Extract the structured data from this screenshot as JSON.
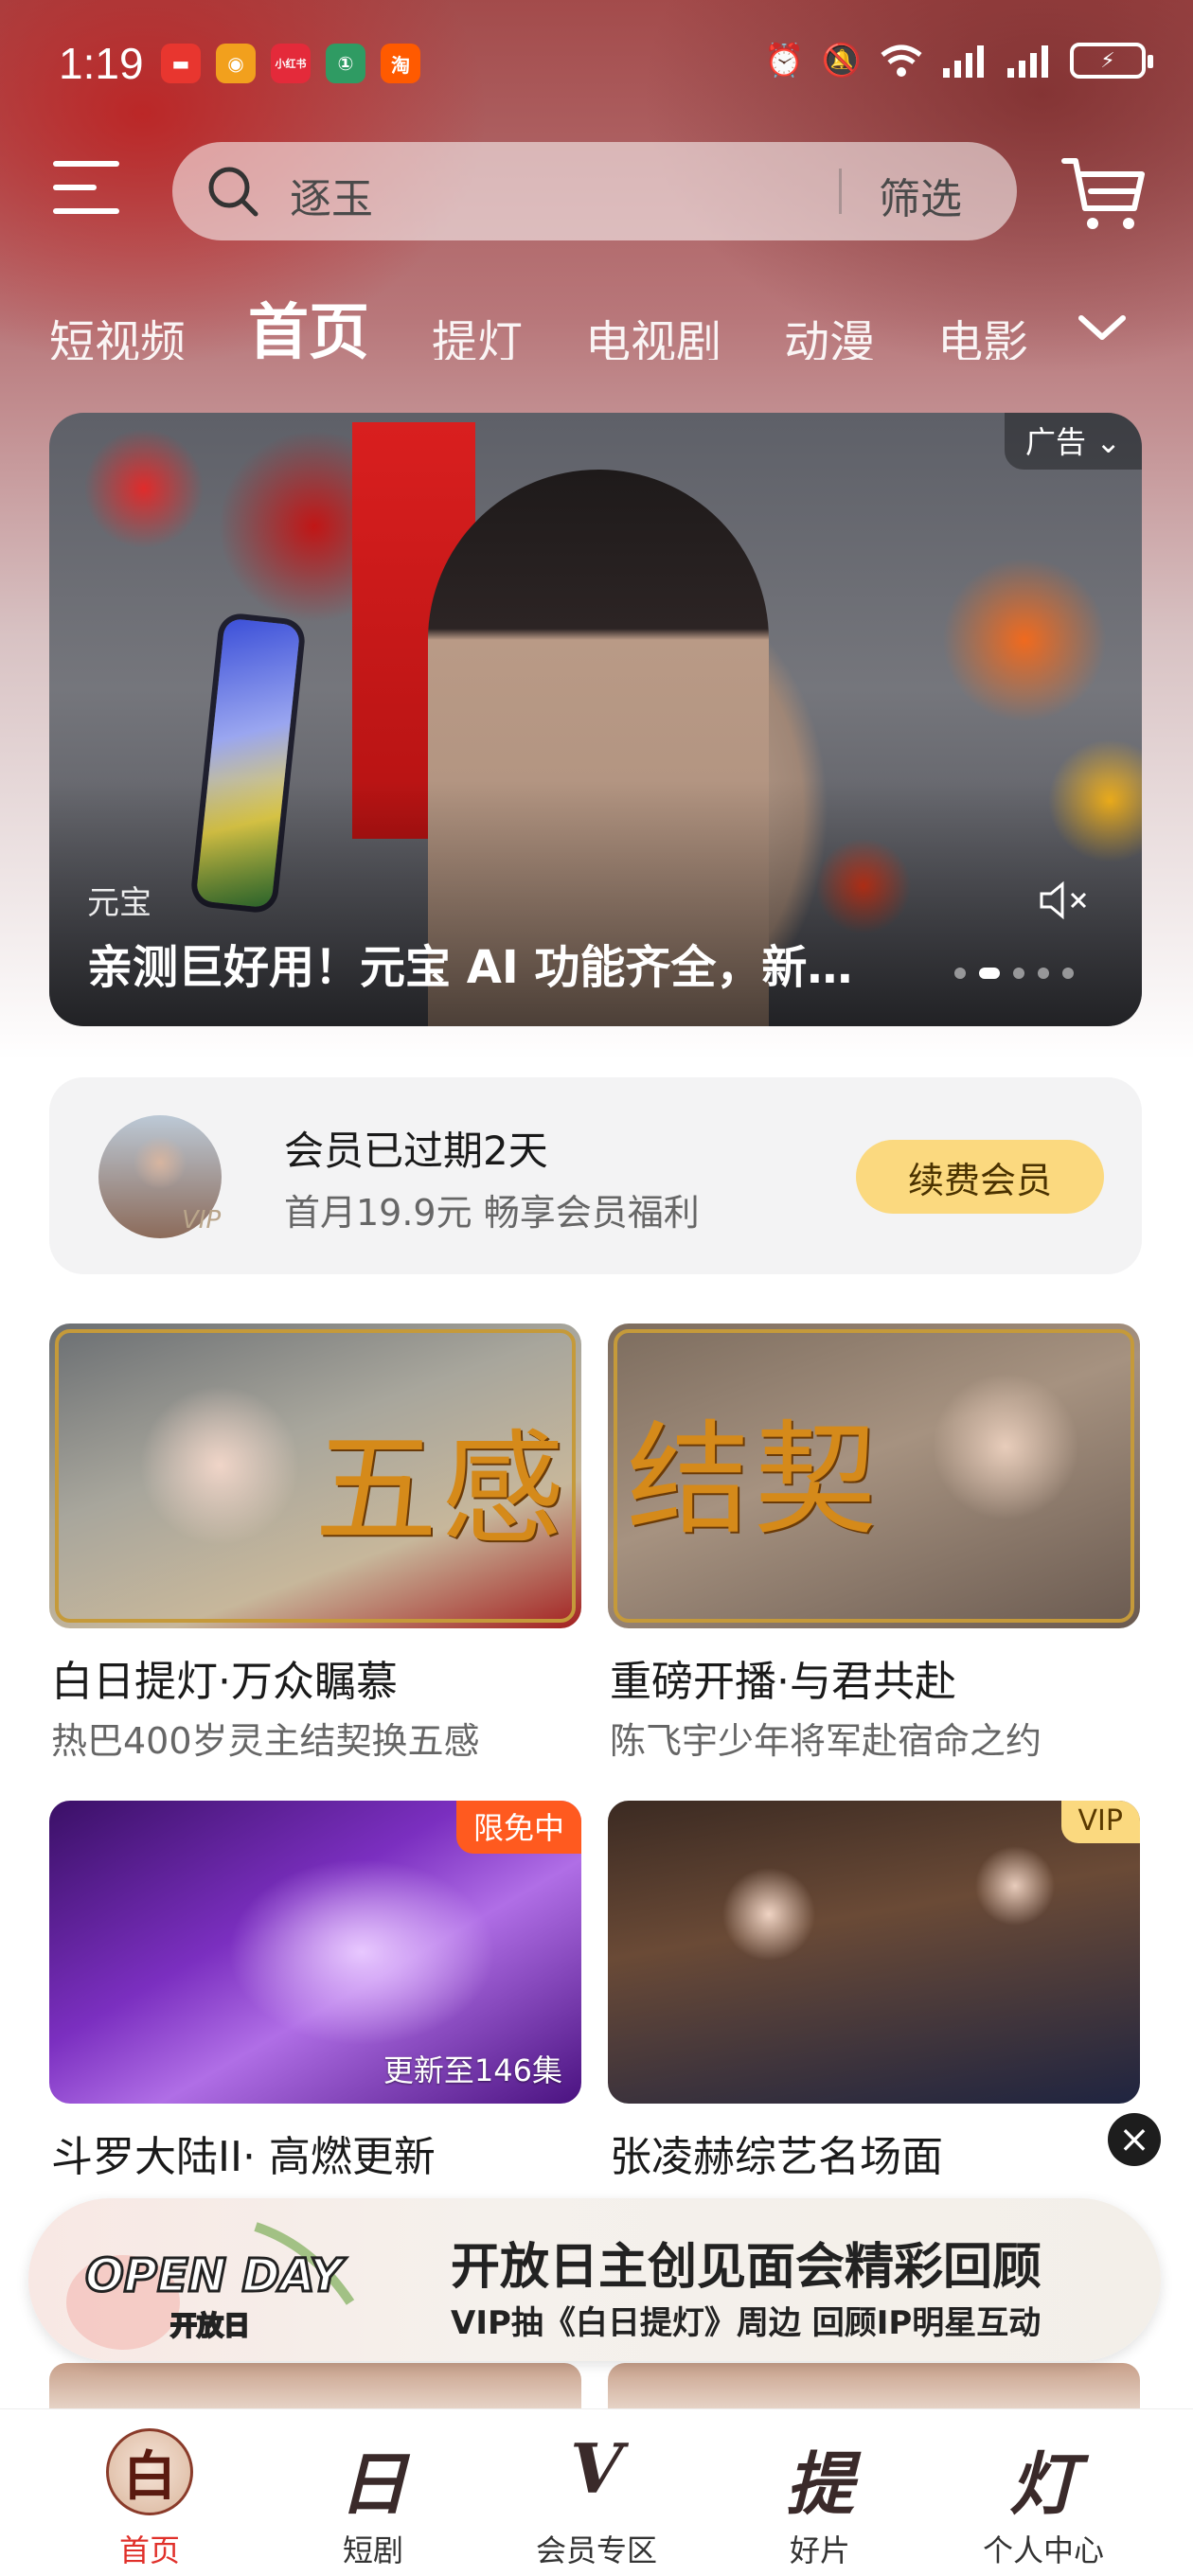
{
  "status_bar": {
    "time": "1:19",
    "app_icons": [
      {
        "name": "red-app-icon",
        "color": "#e8362f",
        "glyph": "▬"
      },
      {
        "name": "weibo-icon",
        "color": "#f2a01d",
        "glyph": "◉"
      },
      {
        "name": "xiaohongshu-icon",
        "color": "#e42a3a",
        "glyph": "小红书"
      },
      {
        "name": "green-app-icon",
        "color": "#2f9b63",
        "glyph": "①"
      },
      {
        "name": "taobao-icon",
        "color": "#ff5a00",
        "glyph": "淘"
      }
    ]
  },
  "search": {
    "query": "逐玉",
    "filter_label": "筛选"
  },
  "tabs": [
    "短视频",
    "首页",
    "提灯",
    "电视剧",
    "动漫",
    "电影"
  ],
  "active_tab": "首页",
  "banner": {
    "ad_label": "广告",
    "source": "元宝",
    "title": "亲测巨好用！元宝 AI 功能齐全，新…"
  },
  "member": {
    "vip_mark": "VIP",
    "title": "会员已过期2天",
    "subtitle": "首月19.9元 畅享会员福利",
    "button": "续费会员"
  },
  "cards": [
    {
      "title": "白日提灯·万众瞩慕",
      "subtitle": "热巴400岁灵主结契换五感",
      "art_text": "五感"
    },
    {
      "title": "重磅开播·与君共赴",
      "subtitle": "陈飞宇少年将军赴宿命之约",
      "art_text": "结契"
    },
    {
      "title": "斗罗大陆II· 高燃更新",
      "badge": "限免中",
      "episode_info": "更新至146集"
    },
    {
      "title": "张凌赫综艺名场面",
      "badge": "VIP"
    }
  ],
  "float_banner": {
    "logo_text": "OPEN DAY",
    "logo_sub": "开放日",
    "title": "开放日主创见面会精彩回顾",
    "subtitle": "VIP抽《白日提灯》周边 回顾IP明星互动"
  },
  "bottom_nav": [
    {
      "label": "首页",
      "glyph": "白",
      "active": true
    },
    {
      "label": "短剧",
      "glyph": "日"
    },
    {
      "label": "会员专区",
      "glyph": "V"
    },
    {
      "label": "好片",
      "glyph": "提"
    },
    {
      "label": "个人中心",
      "glyph": "灯"
    }
  ],
  "colors": {
    "accent_red": "#e0302a",
    "vip_gold": "#fbd97f",
    "free_badge": "#ff5a1f"
  }
}
